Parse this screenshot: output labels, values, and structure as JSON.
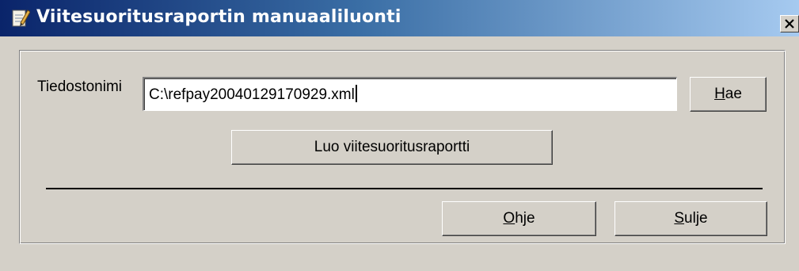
{
  "window": {
    "title": "Viitesuoritusraportin manuaaliluonti",
    "icon": "notepad-pencil-icon",
    "close_glyph": "×"
  },
  "form": {
    "filename_label": "Tiedostonimi",
    "filename_value": "C:\\refpay20040129170929.xml",
    "browse_button": {
      "mnemonic": "H",
      "rest": "ae"
    },
    "create_report_button": "Luo viitesuoritusraportti"
  },
  "footer": {
    "help_button": {
      "mnemonic": "O",
      "rest": "hje"
    },
    "close_button": {
      "mnemonic": "S",
      "rest": "ulje"
    }
  },
  "colors": {
    "titlebar_start": "#0a246a",
    "titlebar_end": "#a6caf0",
    "dialog_face": "#d4d0c8"
  }
}
